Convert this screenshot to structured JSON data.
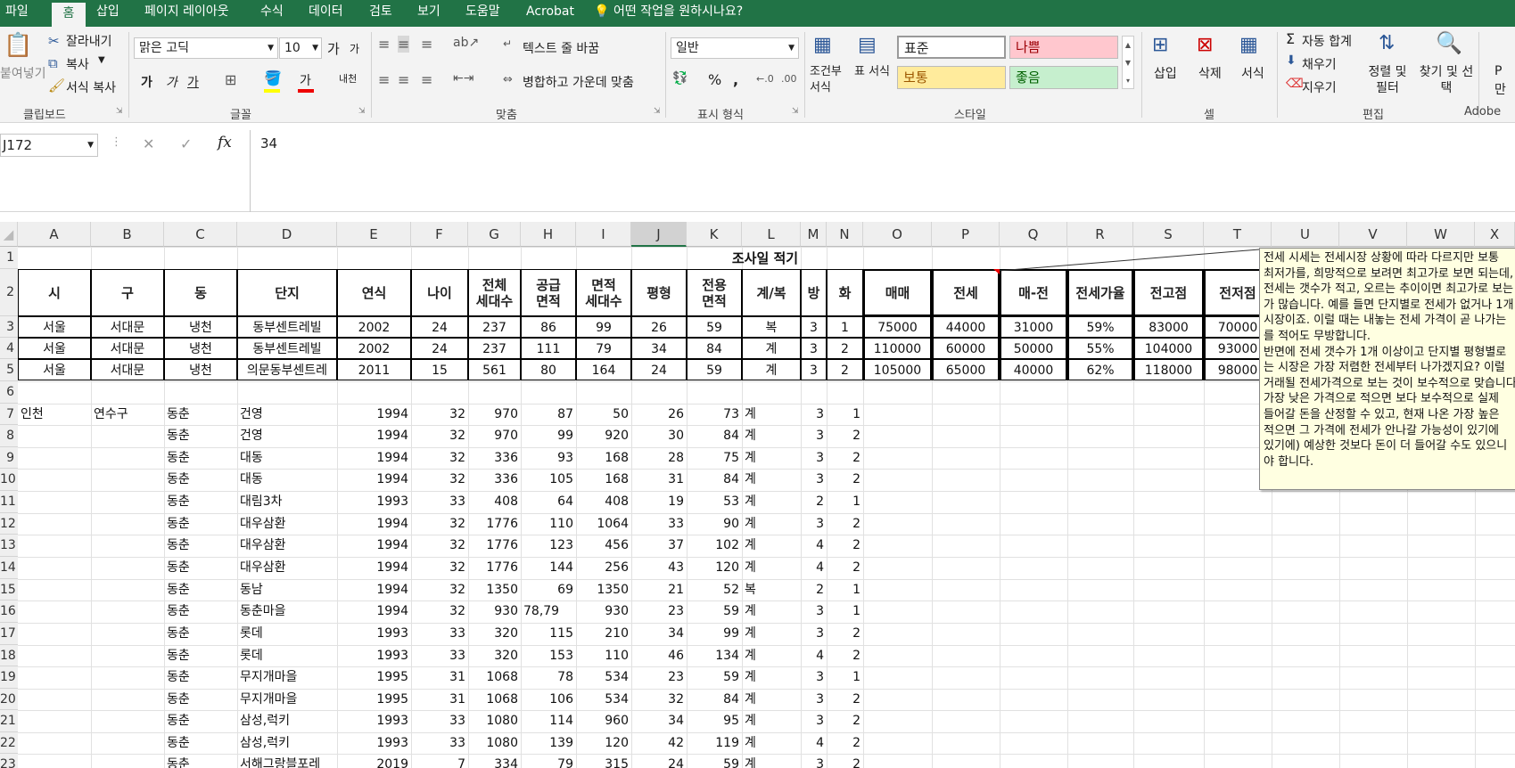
{
  "menu": [
    "파일",
    "홈",
    "삽입",
    "페이지 레이아웃",
    "수식",
    "데이터",
    "검토",
    "보기",
    "도움말",
    "Acrobat",
    "어떤 작업을 원하시나요?"
  ],
  "clipboard": {
    "paste": "붙여넣기",
    "cut": "잘라내기",
    "copy": "복사",
    "format_painter": "서식 복사",
    "label": "클립보드"
  },
  "font": {
    "name": "맑은 고딕",
    "size": "10",
    "label": "글꼴",
    "grow": "가",
    "shrink": "가",
    "bold": "가",
    "italic": "가",
    "underline": "가",
    "color_letter": "가",
    "phonetic": "내천"
  },
  "alignment": {
    "wrap": "텍스트 줄 바꿈",
    "merge": "병합하고 가운데 맞춤",
    "label": "맞춤"
  },
  "number": {
    "format": "일반",
    "label": "표시 형식",
    "percent": "%",
    "comma": ","
  },
  "styles": {
    "cond": "조건부 서식",
    "table": "표 서식",
    "normal": "표준",
    "bad": "나쁨",
    "neutral": "보통",
    "good": "좋음",
    "label": "스타일",
    "colors": {
      "bad": "#ffc7ce",
      "neutral": "#ffeb9c",
      "good": "#c6efce"
    }
  },
  "cells_group": {
    "insert": "삽입",
    "delete": "삭제",
    "format": "서식",
    "label": "셀"
  },
  "editing": {
    "autosum": "자동 합계",
    "fill": "채우기",
    "clear": "지우기",
    "sort": "정렬 및 필터",
    "find": "찾기 및 선택",
    "label": "편집"
  },
  "adobe": {
    "label": "Adobe",
    "make": "P",
    "make2": "만"
  },
  "formula": {
    "namebox": "J172",
    "value": "34",
    "cancel": "✕",
    "enter": "✓",
    "fx": "fx"
  },
  "columns": [
    "A",
    "B",
    "C",
    "D",
    "E",
    "F",
    "G",
    "H",
    "I",
    "J",
    "K",
    "L",
    "M",
    "N",
    "O",
    "P",
    "Q",
    "R",
    "S",
    "T",
    "U",
    "V",
    "W",
    "X"
  ],
  "rows": [
    "1",
    "2",
    "3",
    "4",
    "5",
    "6",
    "7",
    "8",
    "9",
    "10",
    "11",
    "12",
    "13",
    "14",
    "15",
    "16",
    "17",
    "18",
    "19",
    "20",
    "21",
    "22",
    "23"
  ],
  "title": "조사일 적기",
  "headers": [
    "시",
    "구",
    "동",
    "단지",
    "연식",
    "나이",
    "전체\n세대수",
    "공급\n면적",
    "면적\n세대수",
    "평형",
    "전용\n면적",
    "계/복",
    "방",
    "화",
    "매매",
    "전세",
    "매-전",
    "전세가율",
    "전고점",
    "전저점"
  ],
  "top_rows": [
    [
      "서울",
      "서대문",
      "냉천",
      "동부센트레빌",
      "2002",
      "24",
      "237",
      "86",
      "99",
      "26",
      "59",
      "복",
      "3",
      "1",
      "75000",
      "44000",
      "31000",
      "59%",
      "83000",
      "70000"
    ],
    [
      "서울",
      "서대문",
      "냉천",
      "동부센트레빌",
      "2002",
      "24",
      "237",
      "111",
      "79",
      "34",
      "84",
      "계",
      "3",
      "2",
      "110000",
      "60000",
      "50000",
      "55%",
      "104000",
      "93000"
    ],
    [
      "서울",
      "서대문",
      "냉천",
      "의문동부센트레",
      "2011",
      "15",
      "561",
      "80",
      "164",
      "24",
      "59",
      "계",
      "3",
      "2",
      "105000",
      "65000",
      "40000",
      "62%",
      "118000",
      "98000"
    ]
  ],
  "data_rows": [
    [
      "인천",
      "연수구",
      "동춘",
      "건영",
      "1994",
      "32",
      "970",
      "87",
      "50",
      "26",
      "73",
      "계",
      "3",
      "1"
    ],
    [
      "",
      "",
      "동춘",
      "건영",
      "1994",
      "32",
      "970",
      "99",
      "920",
      "30",
      "84",
      "계",
      "3",
      "2"
    ],
    [
      "",
      "",
      "동춘",
      "대동",
      "1994",
      "32",
      "336",
      "93",
      "168",
      "28",
      "75",
      "계",
      "3",
      "2"
    ],
    [
      "",
      "",
      "동춘",
      "대동",
      "1994",
      "32",
      "336",
      "105",
      "168",
      "31",
      "84",
      "계",
      "3",
      "2"
    ],
    [
      "",
      "",
      "동춘",
      "대림3차",
      "1993",
      "33",
      "408",
      "64",
      "408",
      "19",
      "53",
      "계",
      "2",
      "1"
    ],
    [
      "",
      "",
      "동춘",
      "대우삼환",
      "1994",
      "32",
      "1776",
      "110",
      "1064",
      "33",
      "90",
      "계",
      "3",
      "2"
    ],
    [
      "",
      "",
      "동춘",
      "대우삼환",
      "1994",
      "32",
      "1776",
      "123",
      "456",
      "37",
      "102",
      "계",
      "4",
      "2"
    ],
    [
      "",
      "",
      "동춘",
      "대우삼환",
      "1994",
      "32",
      "1776",
      "144",
      "256",
      "43",
      "120",
      "계",
      "4",
      "2"
    ],
    [
      "",
      "",
      "동춘",
      "동남",
      "1994",
      "32",
      "1350",
      "69",
      "1350",
      "21",
      "52",
      "복",
      "2",
      "1"
    ],
    [
      "",
      "",
      "동춘",
      "동춘마을",
      "1994",
      "32",
      "930",
      "78,79",
      "930",
      "23",
      "59",
      "계",
      "3",
      "1"
    ],
    [
      "",
      "",
      "동춘",
      "롯데",
      "1993",
      "33",
      "320",
      "115",
      "210",
      "34",
      "99",
      "계",
      "3",
      "2"
    ],
    [
      "",
      "",
      "동춘",
      "롯데",
      "1993",
      "33",
      "320",
      "153",
      "110",
      "46",
      "134",
      "계",
      "4",
      "2"
    ],
    [
      "",
      "",
      "동춘",
      "무지개마을",
      "1995",
      "31",
      "1068",
      "78",
      "534",
      "23",
      "59",
      "계",
      "3",
      "1"
    ],
    [
      "",
      "",
      "동춘",
      "무지개마을",
      "1995",
      "31",
      "1068",
      "106",
      "534",
      "32",
      "84",
      "계",
      "3",
      "2"
    ],
    [
      "",
      "",
      "동춘",
      "삼성,럭키",
      "1993",
      "33",
      "1080",
      "114",
      "960",
      "34",
      "95",
      "계",
      "3",
      "2"
    ],
    [
      "",
      "",
      "동춘",
      "삼성,럭키",
      "1993",
      "33",
      "1080",
      "139",
      "120",
      "42",
      "119",
      "계",
      "4",
      "2"
    ],
    [
      "",
      "",
      "동춘",
      "서해그랑블포레",
      "2019",
      "7",
      "334",
      "79",
      "315",
      "24",
      "59",
      "계",
      "3",
      "2"
    ]
  ],
  "comment": {
    "lines": [
      "전세 시세는 전세시장 상황에 따라 다르지만 보통",
      "최저가를, 희망적으로 보려면 최고가로 보면 되는데,",
      "전세는 갯수가 적고, 오르는 추이이면 최고가로 보는",
      "가 많습니다. 예를 들면 단지별로 전세가 없거나 1개",
      "시장이죠. 이럴 때는 내놓는 전세 가격이 곧 나가는",
      "를 적어도 무방합니다.",
      "반면에 전세 갯수가 1개 이상이고 단지별 평형별로",
      "는 시장은 가장 저렴한 전세부터 나가겠지요? 이럴",
      "거래될 전세가격으로 보는 것이 보수적으로 맞습니다",
      "가장 낮은 가격으로 적으면 보다 보수적으로 실제",
      "들어갈 돈을 산정할 수 있고, 현재 나온 가장 높은",
      "적으면 그 가격에 전세가 안나갈 가능성이 있기에",
      "있기에) 예상한 것보다 돈이 더 들어갈 수도 있으니",
      "야 합니다."
    ]
  }
}
